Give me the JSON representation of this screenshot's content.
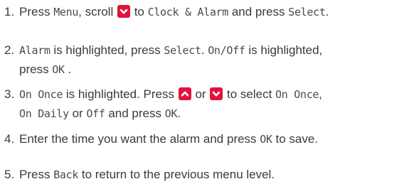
{
  "steps": [
    {
      "number": "1.",
      "lines": [
        {
          "t1": "Press ",
          "menu": "Menu",
          "t2": ", scroll ",
          "t3": " to ",
          "clock": "Clock & Alarm",
          "t4": " and press ",
          "select": "Select",
          "t5": "."
        }
      ]
    },
    {
      "number": "2.",
      "lines": [
        {
          "alarm": "Alarm",
          "t1": " is highlighted, press ",
          "select": "Select",
          "t2": ". ",
          "onoff": "On/Off",
          "t3": " is highlighted,"
        },
        {
          "t1": "press ",
          "ok": "OK",
          "t2": " ."
        }
      ]
    },
    {
      "number": "3.",
      "lines": [
        {
          "ononce": "On Once",
          "t1": " is highlighted. Press ",
          "t2": " or ",
          "t3": " to select ",
          "ononce2": "On Once",
          "t4": ","
        },
        {
          "ondaily": "On Daily",
          "t1": " or ",
          "off": "Off",
          "t2": " and press ",
          "ok": "OK",
          "t3": "."
        }
      ]
    },
    {
      "number": "4.",
      "lines": [
        {
          "t1": "Enter the time you want the alarm and press ",
          "ok": "OK",
          "t2": " to save."
        }
      ]
    },
    {
      "number": "5.",
      "lines": [
        {
          "t1": "Press ",
          "back": "Back",
          "t2": " to return to the previous menu level."
        }
      ]
    }
  ],
  "icons": {
    "down_key": "chevron-down-key",
    "up_key": "chevron-up-key"
  },
  "colors": {
    "text": "#3a3a3a",
    "key_background": "#e3123a",
    "key_glyph": "#ffffff"
  }
}
